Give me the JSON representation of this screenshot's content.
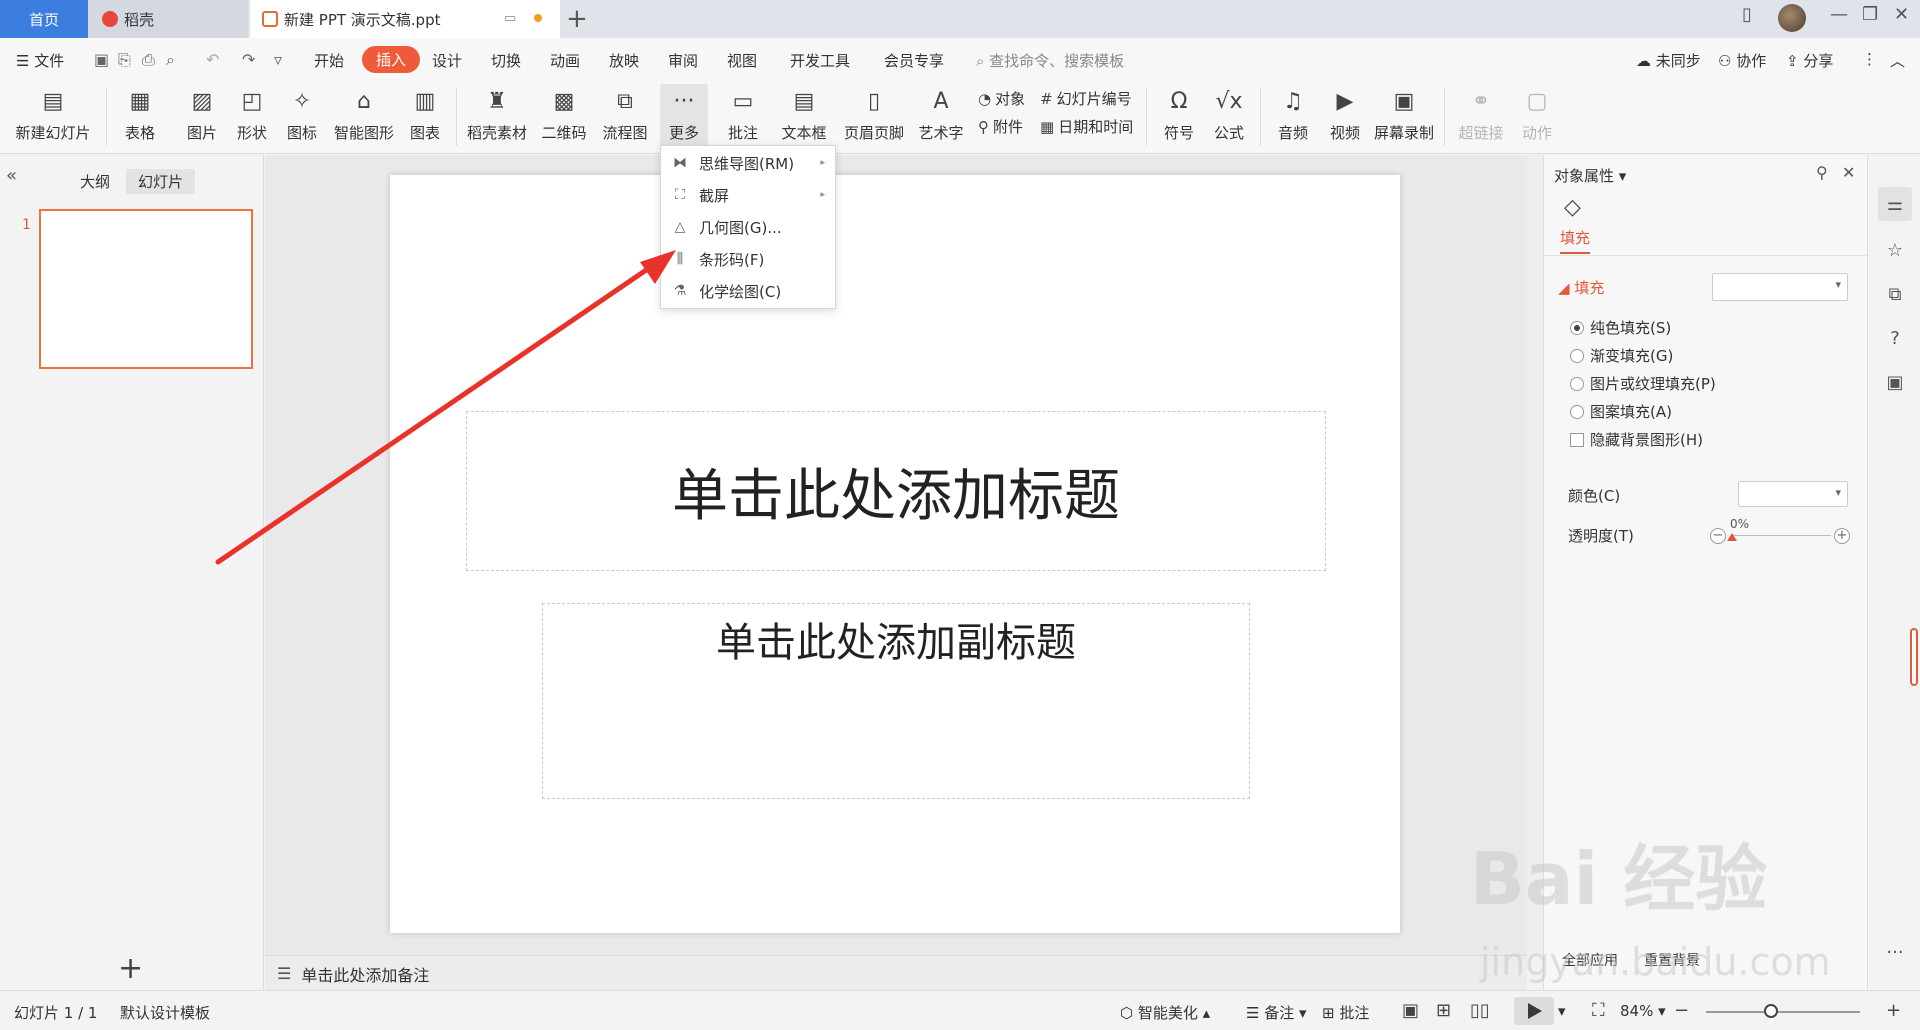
{
  "tabs": {
    "home": "首页",
    "docer": "稻壳",
    "document": "新建 PPT 演示文稿.ppt",
    "add": "+"
  },
  "menu": {
    "file": "文件",
    "items": [
      "开始",
      "插入",
      "设计",
      "切换",
      "动画",
      "放映",
      "审阅",
      "视图",
      "开发工具",
      "会员专享"
    ],
    "active_index": 1,
    "search_placeholder": "查找命令、搜索模板",
    "sync": "未同步",
    "collab": "协作",
    "share": "分享"
  },
  "ribbon": {
    "new_slide": "新建幻灯片",
    "table": "表格",
    "picture": "图片",
    "shape": "形状",
    "icon": "图标",
    "smart_graphic": "智能图形",
    "chart": "图表",
    "docer_material": "稻壳素材",
    "qrcode": "二维码",
    "flowchart": "流程图",
    "more": "更多",
    "comment": "批注",
    "textbox": "文本框",
    "header_footer": "页眉页脚",
    "wordart": "艺术字",
    "object": "对象",
    "slide_number": "幻灯片编号",
    "attachment": "附件",
    "date_time": "日期和时间",
    "symbol": "符号",
    "formula": "公式",
    "audio": "音频",
    "video": "视频",
    "screen_record": "屏幕录制",
    "hyperlink": "超链接",
    "action": "动作"
  },
  "dropdown": {
    "items": [
      {
        "label": "思维导图(RM)",
        "icon": "mindmap-icon",
        "submenu": true
      },
      {
        "label": "截屏",
        "icon": "screenshot-icon",
        "submenu": true
      },
      {
        "label": "几何图(G)...",
        "icon": "geometry-icon",
        "submenu": false
      },
      {
        "label": "条形码(F)",
        "icon": "barcode-icon",
        "submenu": false
      },
      {
        "label": "化学绘图(C)",
        "icon": "chemistry-icon",
        "submenu": false
      }
    ]
  },
  "left_panel": {
    "outline_tab": "大纲",
    "slides_tab": "幻灯片",
    "slide_number": "1",
    "add": "+"
  },
  "slide": {
    "title_placeholder": "单击此处添加标题",
    "subtitle_placeholder": "单击此处添加副标题"
  },
  "notes": {
    "placeholder": "单击此处添加备注"
  },
  "properties": {
    "title": "对象属性",
    "fill_tab": "填充",
    "section": "填充",
    "options": [
      {
        "label": "纯色填充(S)",
        "type": "radio",
        "checked": true
      },
      {
        "label": "渐变填充(G)",
        "type": "radio",
        "checked": false
      },
      {
        "label": "图片或纹理填充(P)",
        "type": "radio",
        "checked": false
      },
      {
        "label": "图案填充(A)",
        "type": "radio",
        "checked": false
      },
      {
        "label": "隐藏背景图形(H)",
        "type": "checkbox",
        "checked": false
      }
    ],
    "color_label": "颜色(C)",
    "transparency_label": "透明度(T)",
    "transparency_value": "0%",
    "apply_all": "全部应用",
    "reset_bg": "重置背景"
  },
  "statusbar": {
    "slide_info": "幻灯片 1 / 1",
    "template": "默认设计模板",
    "smart_beautify": "智能美化",
    "notes": "备注",
    "comments": "批注",
    "zoom": "84%"
  },
  "watermark": {
    "text": "Bai 经验",
    "url": "jingyan.baidu.com"
  },
  "colors": {
    "accent": "#ee5a3a",
    "home_tab": "#3c7de0",
    "annotation_arrow": "#e8322a"
  }
}
